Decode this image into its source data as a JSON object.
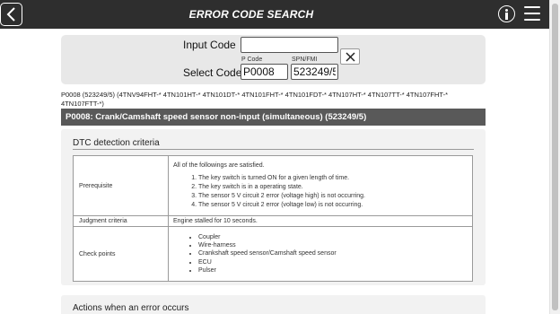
{
  "header": {
    "title": "ERROR CODE SEARCH",
    "icons": {
      "back": "chevron-left-icon",
      "info": "info-icon",
      "menu": "hamburger-menu-icon"
    }
  },
  "search": {
    "input_code_label": "Input Code",
    "input_code_value": "",
    "select_code_label": "Select Code",
    "pcode_label": "P Code",
    "pcode_value": "P0008",
    "spn_label": "SPN/FMI",
    "spn_value": "523249/5",
    "clear_icon": "close-icon"
  },
  "codes_line": "P0008 (523249/5) (4TNV94FHT-* 4TN101HT-* 4TN101DT-* 4TN101FHT-* 4TN101FDT-* 4TN107HT-* 4TN107TT-* 4TN107FHT-* 4TN107FTT-*)",
  "dtc": {
    "heading": "P0008: Crank/Camshaft speed sensor non-input (simultaneous) (523249/5)"
  },
  "detection": {
    "title": "DTC detection criteria",
    "prerequisite_label": "Prerequisite",
    "prerequisite_intro": "All of the followings are satisfied.",
    "conditions": [
      "The key switch is turned ON for a given length of time.",
      "The key switch is in a operating state.",
      "The sensor 5 V circuit 2 error (voltage high) is not occurring.",
      "The sensor 5 V circuit 2 error (voltage low) is not occurring."
    ],
    "judgment_label": "Judgment criteria",
    "judgment_value": "Engine stalled for 10 seconds.",
    "checkpoints_label": "Check points",
    "checkpoints": [
      "Coupler",
      "Wire-harness",
      "Crankshaft speed sensor/Camshaft speed sensor",
      "ECU",
      "Pulser"
    ]
  },
  "actions": {
    "title": "Actions when an error occurs"
  },
  "colors": {
    "header_bg": "#2e2e2e",
    "dtc_bar_bg": "#595959",
    "panel_bg": "#e8e8e8",
    "section_bg": "#f2f2f2"
  }
}
